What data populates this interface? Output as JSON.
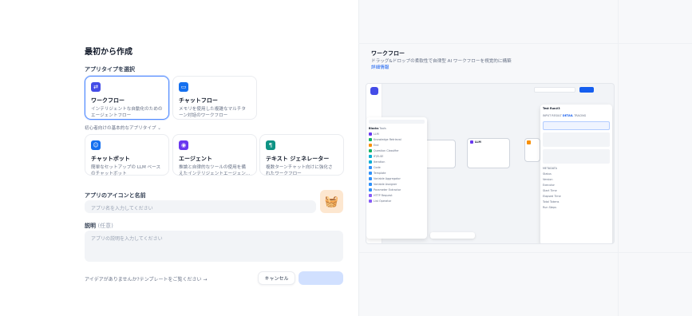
{
  "dialog": {
    "title": "最初から作成",
    "app_type_label": "アプリタイプを選択",
    "app_types": [
      {
        "icon": "workflow-icon",
        "title": "ワークフロー",
        "desc1": "インテリジェントな自動化のための",
        "desc2": "エージェントフロー",
        "color": "#444ce7",
        "selected": true
      },
      {
        "icon": "chat-bubble-icon",
        "title": "チャットフロー",
        "desc1": "メモリを使用した複雑なマルチタ",
        "desc2": "ーン対話のワークフロー",
        "color": "#1570ef",
        "selected": false
      }
    ],
    "beginner_label": "初心者向けの基本的なアプリタイプ",
    "basic_types": [
      {
        "icon": "chatbot-icon",
        "title": "チャットボット",
        "desc1": "簡単なセットアップの LLM ベース",
        "desc2": "のチャットボット",
        "color": "#1570ef"
      },
      {
        "icon": "agent-icon",
        "title": "エージェント",
        "desc1": "推論と自律的なツールの使用を備",
        "desc2": "えたインテリジェントエージェン…",
        "color": "#6938ef"
      },
      {
        "icon": "text-generator-icon",
        "title": "テキスト ジェネレーター",
        "desc1": "複数ターンチャット向けに強化さ",
        "desc2": "れたワークフロー",
        "color": "#0e9384"
      }
    ],
    "icon_name_label": "アプリのアイコンと名前",
    "name_placeholder": "アプリ名を入力してください",
    "app_icon_emoji": "🧺",
    "description_label": "説明",
    "description_optional": "(任意)",
    "description_placeholder": "アプリの説明を入力してください",
    "template_link": "アイデアがありませんか?テンプレートをご覧ください →",
    "cancel_label": "キャンセル"
  },
  "preview": {
    "title": "ワークフロー",
    "description": "ドラッグ&ドロップの柔軟性で自律型 AI ワークフローを視覚的に構築",
    "learn_more": "詳細情報"
  }
}
